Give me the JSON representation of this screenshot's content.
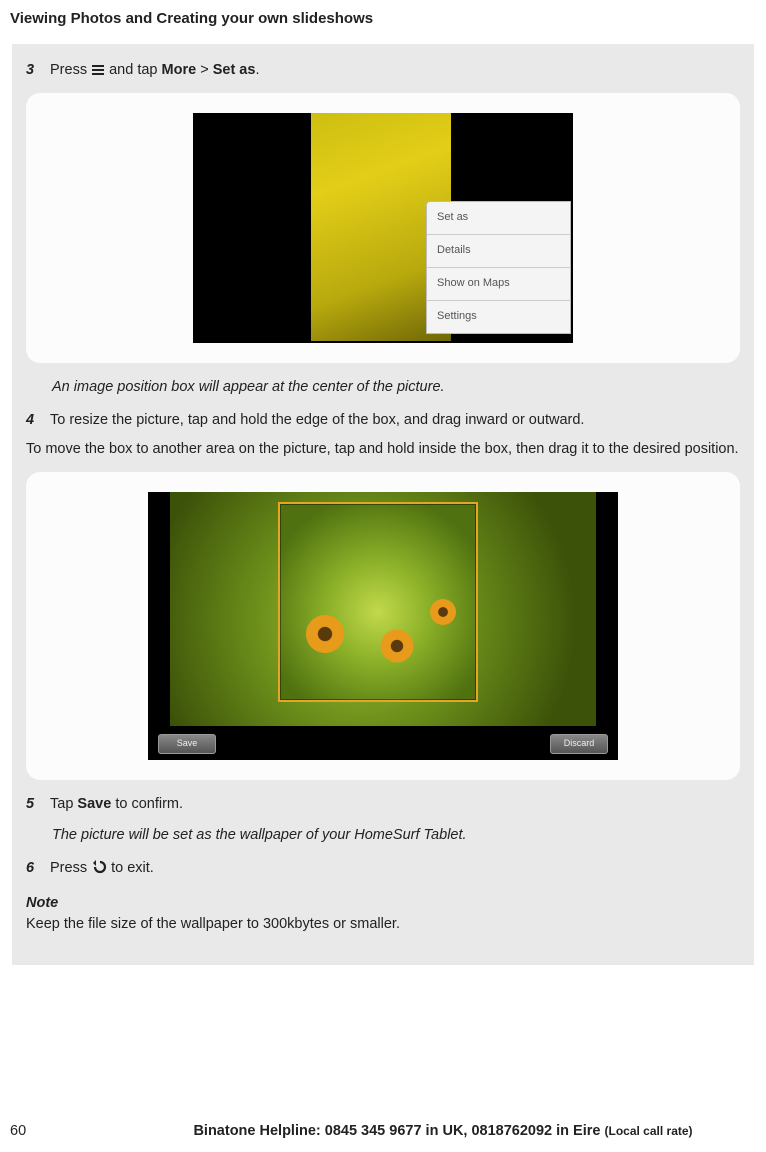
{
  "header": "Viewing Photos and Creating your own slideshows",
  "step3": {
    "num": "3",
    "press": "Press ",
    "and_tap": " and tap ",
    "more": "More",
    "gt": " > ",
    "set_as": "Set as",
    "dot": "."
  },
  "fig1": {
    "menu": [
      "Set as",
      "Details",
      "Show on Maps",
      "Settings"
    ]
  },
  "caption1": "An image position box will appear at the center of the picture.",
  "step4": {
    "num": "4",
    "text": "To resize the picture, tap and hold the edge of the box, and drag inward or outward."
  },
  "body_move": "To move the box to another area on the picture, tap and hold inside the box, then drag it to the desired position.",
  "fig2": {
    "save": "Save",
    "discard": "Discard"
  },
  "step5": {
    "num": "5",
    "tap": "Tap ",
    "save": "Save",
    "confirm": " to confirm."
  },
  "caption2": "The picture will be set as the wallpaper of your HomeSurf Tablet.",
  "step6": {
    "num": "6",
    "press": "Press ",
    "exit": " to exit."
  },
  "note": {
    "label": "Note",
    "text": "Keep the file size of the wallpaper to 300kbytes or smaller."
  },
  "footer": {
    "page": "60",
    "helpline": "Binatone Helpline: 0845 345 9677 in UK, 0818762092 in Eire ",
    "rate": "(Local call rate)"
  }
}
